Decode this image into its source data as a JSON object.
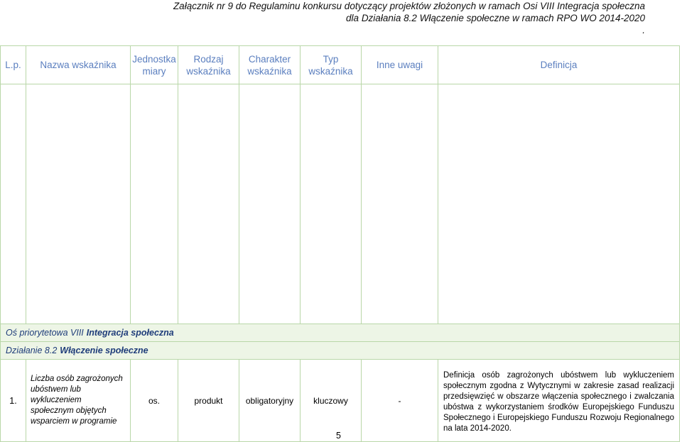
{
  "header": {
    "line1": "Załącznik nr 9 do Regulaminu konkursu dotyczący projektów złożonych w ramach Osi VIII Integracja społeczna",
    "line2": "dla Działania 8.2 Włączenie społeczne w ramach RPO WO 2014-2020",
    "line3": "."
  },
  "table": {
    "headers": {
      "lp": "L.p.",
      "name": "Nazwa wskaźnika",
      "unit": "Jednostka miary",
      "kind": "Rodzaj wskaźnika",
      "character": "Charakter wskaźnika",
      "type": "Typ wskaźnika",
      "notes": "Inne uwagi",
      "definition": "Definicja"
    },
    "axis": {
      "prefix": "Oś priorytetowa VIII",
      "name": "Integracja społeczna"
    },
    "measure": {
      "prefix": "Działanie 8.2",
      "name": "Włączenie społeczne"
    },
    "rows": [
      {
        "lp": "1.",
        "name": "Liczba osób zagrożonych ubóstwem lub wykluczeniem społecznym objętych wsparciem w programie",
        "unit": "os.",
        "kind": "produkt",
        "character": "obligatoryjny",
        "type": "kluczowy",
        "notes": "-",
        "definition": "Definicja osób zagrożonych ubóstwem lub wykluczeniem społecznym zgodna z Wytycznymi w zakresie zasad realizacji przedsięwzięć w obszarze włączenia społecznego i zwalczania ubóstwa z wykorzystaniem środków Europejskiego Funduszu Społecznego i Europejskiego Funduszu Rozwoju Regionalnego na lata 2014-2020."
      }
    ]
  },
  "footer": {
    "page_number": "5"
  },
  "colors": {
    "header_text": "#5b7fbf",
    "border": "#b9d7a8",
    "band_bg": "#edf5e6",
    "band_text": "#1f3d7a"
  }
}
